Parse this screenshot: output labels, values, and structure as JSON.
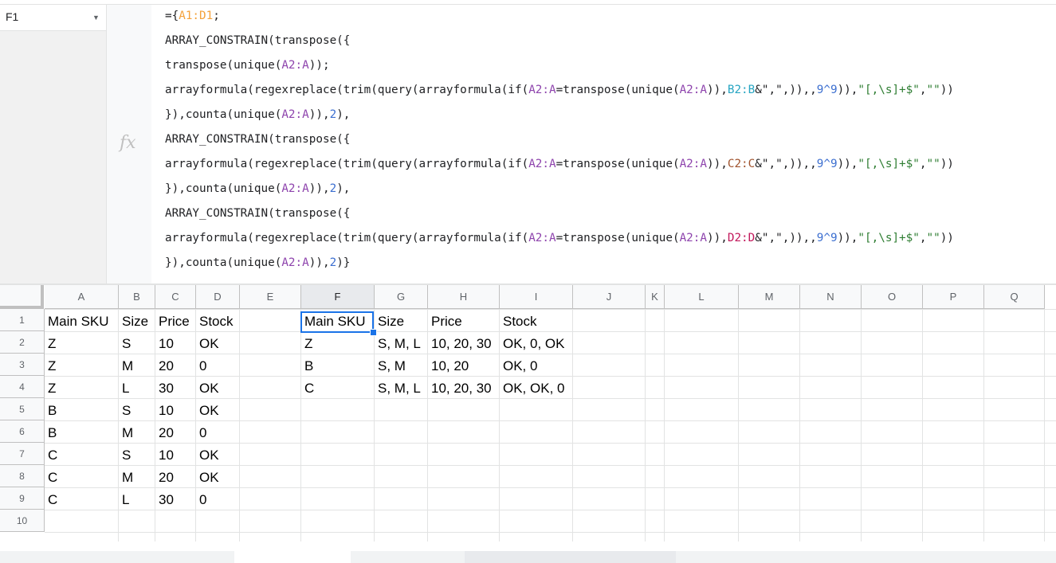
{
  "name_box": {
    "value": "F1"
  },
  "formula_bar": {
    "fx_label": "fx",
    "lines": [
      [
        {
          "t": "={",
          "c": ""
        },
        {
          "t": "A1:D1",
          "c": "or"
        },
        {
          "t": ";",
          "c": ""
        }
      ],
      [
        {
          "t": "ARRAY_CONSTRAIN(transpose({",
          "c": ""
        }
      ],
      [
        {
          "t": "transpose(unique(",
          "c": ""
        },
        {
          "t": "A2:A",
          "c": "pu"
        },
        {
          "t": "));",
          "c": ""
        }
      ],
      [
        {
          "t": "arrayformula(regexreplace(trim(query(arrayformula(if(",
          "c": ""
        },
        {
          "t": "A2:A",
          "c": "pu"
        },
        {
          "t": "=transpose(unique(",
          "c": ""
        },
        {
          "t": "A2:A",
          "c": "pu"
        },
        {
          "t": ")),",
          "c": ""
        },
        {
          "t": "B2:B",
          "c": "cy"
        },
        {
          "t": "&\",\",)),,",
          "c": ""
        },
        {
          "t": "9^9",
          "c": "bl"
        },
        {
          "t": ")),",
          "c": ""
        },
        {
          "t": "\"[,\\s]+$\"",
          "c": "gr"
        },
        {
          "t": ",",
          "c": ""
        },
        {
          "t": "\"\"",
          "c": "gr"
        },
        {
          "t": "))",
          "c": ""
        }
      ],
      [
        {
          "t": "}),counta(unique(",
          "c": ""
        },
        {
          "t": "A2:A",
          "c": "pu"
        },
        {
          "t": ")),",
          "c": ""
        },
        {
          "t": "2",
          "c": "bl"
        },
        {
          "t": "),",
          "c": ""
        }
      ],
      [
        {
          "t": "ARRAY_CONSTRAIN(transpose({",
          "c": ""
        }
      ],
      [
        {
          "t": "arrayformula(regexreplace(trim(query(arrayformula(if(",
          "c": ""
        },
        {
          "t": "A2:A",
          "c": "pu"
        },
        {
          "t": "=transpose(unique(",
          "c": ""
        },
        {
          "t": "A2:A",
          "c": "pu"
        },
        {
          "t": ")),",
          "c": ""
        },
        {
          "t": "C2:C",
          "c": "br"
        },
        {
          "t": "&\",\",)),,",
          "c": ""
        },
        {
          "t": "9^9",
          "c": "bl"
        },
        {
          "t": ")),",
          "c": ""
        },
        {
          "t": "\"[,\\s]+$\"",
          "c": "gr"
        },
        {
          "t": ",",
          "c": ""
        },
        {
          "t": "\"\"",
          "c": "gr"
        },
        {
          "t": "))",
          "c": ""
        }
      ],
      [
        {
          "t": "}),counta(unique(",
          "c": ""
        },
        {
          "t": "A2:A",
          "c": "pu"
        },
        {
          "t": ")),",
          "c": ""
        },
        {
          "t": "2",
          "c": "bl"
        },
        {
          "t": "),",
          "c": ""
        }
      ],
      [
        {
          "t": "ARRAY_CONSTRAIN(transpose({",
          "c": ""
        }
      ],
      [
        {
          "t": "arrayformula(regexreplace(trim(query(arrayformula(if(",
          "c": ""
        },
        {
          "t": "A2:A",
          "c": "pu"
        },
        {
          "t": "=transpose(unique(",
          "c": ""
        },
        {
          "t": "A2:A",
          "c": "pu"
        },
        {
          "t": ")),",
          "c": ""
        },
        {
          "t": "D2:D",
          "c": "rd"
        },
        {
          "t": "&\",\",)),,",
          "c": ""
        },
        {
          "t": "9^9",
          "c": "bl"
        },
        {
          "t": ")),",
          "c": ""
        },
        {
          "t": "\"[,\\s]+$\"",
          "c": "gr"
        },
        {
          "t": ",",
          "c": ""
        },
        {
          "t": "\"\"",
          "c": "gr"
        },
        {
          "t": "))",
          "c": ""
        }
      ],
      [
        {
          "t": "}),counta(unique(",
          "c": ""
        },
        {
          "t": "A2:A",
          "c": "pu"
        },
        {
          "t": ")),",
          "c": ""
        },
        {
          "t": "2",
          "c": "bl"
        },
        {
          "t": ")}",
          "c": ""
        }
      ]
    ]
  },
  "columns": [
    "A",
    "B",
    "C",
    "D",
    "E",
    "F",
    "G",
    "H",
    "I",
    "J",
    "K",
    "L",
    "M",
    "N",
    "O",
    "P",
    "Q"
  ],
  "selected_column": "F",
  "rows": [
    "1",
    "2",
    "3",
    "4",
    "5",
    "6",
    "7",
    "8",
    "9",
    "10"
  ],
  "cells": {
    "A": [
      "Main SKU",
      "Z",
      "Z",
      "Z",
      "B",
      "B",
      "C",
      "C",
      "C"
    ],
    "B": [
      "Size",
      "S",
      "M",
      "L",
      "S",
      "M",
      "S",
      "M",
      "L"
    ],
    "C": [
      "Price",
      "10",
      "20",
      "30",
      "10",
      "20",
      "10",
      "20",
      "30"
    ],
    "D": [
      "Stock",
      "OK",
      "0",
      "OK",
      "OK",
      "0",
      "OK",
      "OK",
      "0"
    ],
    "F": [
      "Main SKU",
      "Z",
      "B",
      "C"
    ],
    "G": [
      "Size",
      "S, M, L",
      "S, M",
      "S, M, L"
    ],
    "H": [
      "Price",
      "10, 20, 30",
      "10, 20",
      "10, 20, 30"
    ],
    "I": [
      "Stock",
      "OK, 0, OK",
      "OK, 0",
      "OK, OK, 0"
    ]
  },
  "selected_cell": "F1",
  "colors": {
    "selection": "#1a73e8",
    "grid_line": "#e2e3e3",
    "header_bg": "#f8f9fa"
  }
}
